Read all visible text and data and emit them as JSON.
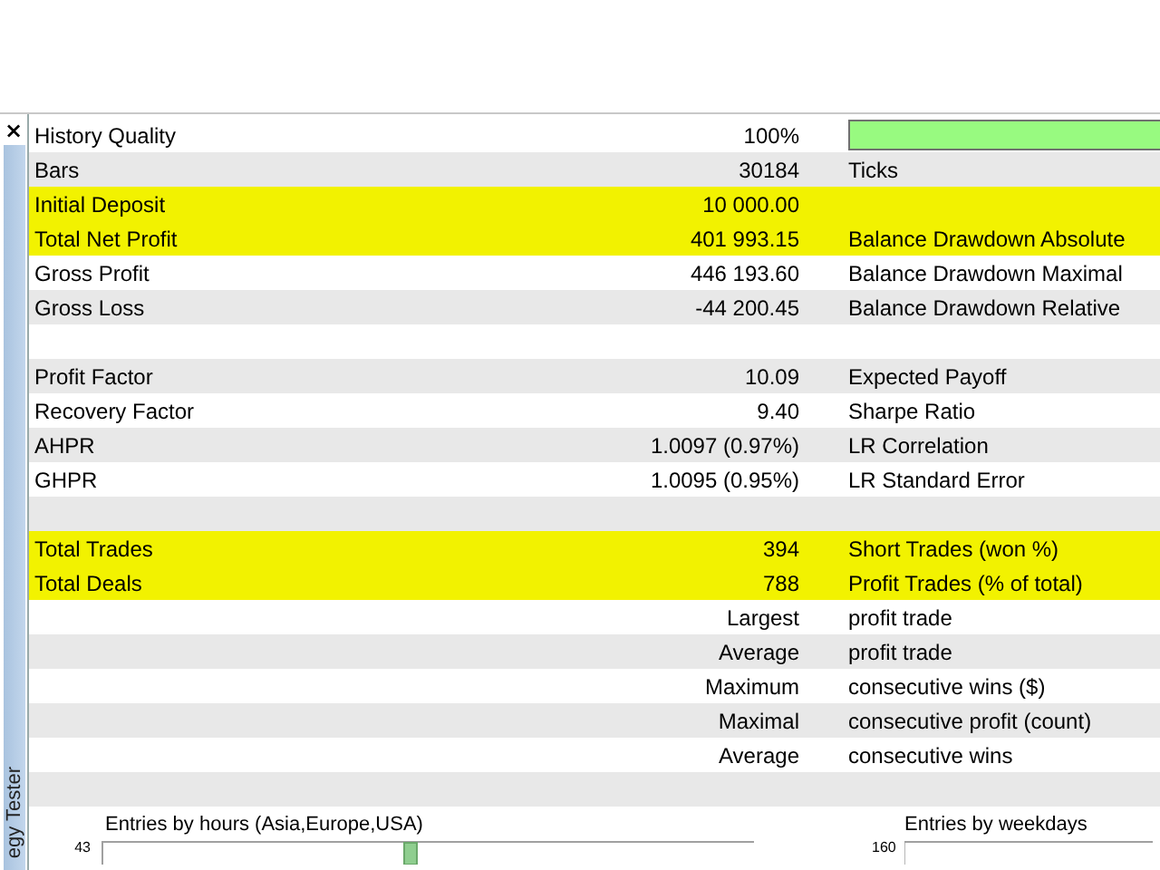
{
  "panel": {
    "close": "×",
    "side_tab": "egy Tester"
  },
  "rows": [
    {
      "kind": "quality",
      "label": "History Quality",
      "value": "100%",
      "level": 1,
      "highlighted": false
    },
    {
      "kind": "stat",
      "label": "Bars",
      "value": "30184",
      "label_2": "Ticks",
      "highlighted": false
    },
    {
      "kind": "stat",
      "label": "Initial Deposit",
      "value": "10 000.00",
      "highlighted": true
    },
    {
      "kind": "stat",
      "label": "Total Net Profit",
      "value": "401 993.15",
      "label_2": "Balance Drawdown Absolute",
      "highlighted": true
    },
    {
      "kind": "stat",
      "label": "Gross Profit",
      "value": "446 193.60",
      "label_2": "Balance Drawdown Maximal",
      "highlighted": false
    },
    {
      "kind": "stat",
      "label": "Gross Loss",
      "value": "-44 200.45",
      "label_2": "Balance Drawdown Relative",
      "highlighted": false
    },
    {
      "kind": "blank",
      "highlighted": false
    },
    {
      "kind": "stat",
      "label": "Profit Factor",
      "value": "10.09",
      "label_2": "Expected Payoff",
      "highlighted": false
    },
    {
      "kind": "stat",
      "label": "Recovery Factor",
      "value": "9.40",
      "label_2": "Sharpe Ratio",
      "highlighted": false
    },
    {
      "kind": "stat",
      "label": "AHPR",
      "value": "1.0097 (0.97%)",
      "label_2": "LR Correlation",
      "highlighted": false
    },
    {
      "kind": "stat",
      "label": "GHPR",
      "value": "1.0095 (0.95%)",
      "label_2": "LR Standard Error",
      "highlighted": false
    },
    {
      "kind": "blank",
      "highlighted": false
    },
    {
      "kind": "stat",
      "label": "Total Trades",
      "value": "394",
      "label_2": "Short Trades (won %)",
      "highlighted": true
    },
    {
      "kind": "stat",
      "label": "Total Deals",
      "value": "788",
      "label_2": "Profit Trades (% of total)",
      "highlighted": true
    },
    {
      "kind": "stat",
      "value": "Largest",
      "label_2": "profit trade",
      "highlighted": false
    },
    {
      "kind": "stat",
      "value": "Average",
      "label_2": "profit trade",
      "highlighted": false
    },
    {
      "kind": "stat",
      "value": "Maximum",
      "label_2": "consecutive wins ($)",
      "highlighted": false
    },
    {
      "kind": "stat",
      "value": "Maximal",
      "label_2": "consecutive profit (count)",
      "highlighted": false
    },
    {
      "kind": "stat",
      "value": "Average",
      "label_2": "consecutive wins",
      "highlighted": false
    },
    {
      "kind": "blank",
      "highlighted": false
    }
  ],
  "charts": [
    {
      "title": "Entries by hours (Asia,Europe,USA)",
      "axis_label": "43"
    },
    {
      "title": "Entries by weekdays",
      "axis_label": "160"
    }
  ]
}
